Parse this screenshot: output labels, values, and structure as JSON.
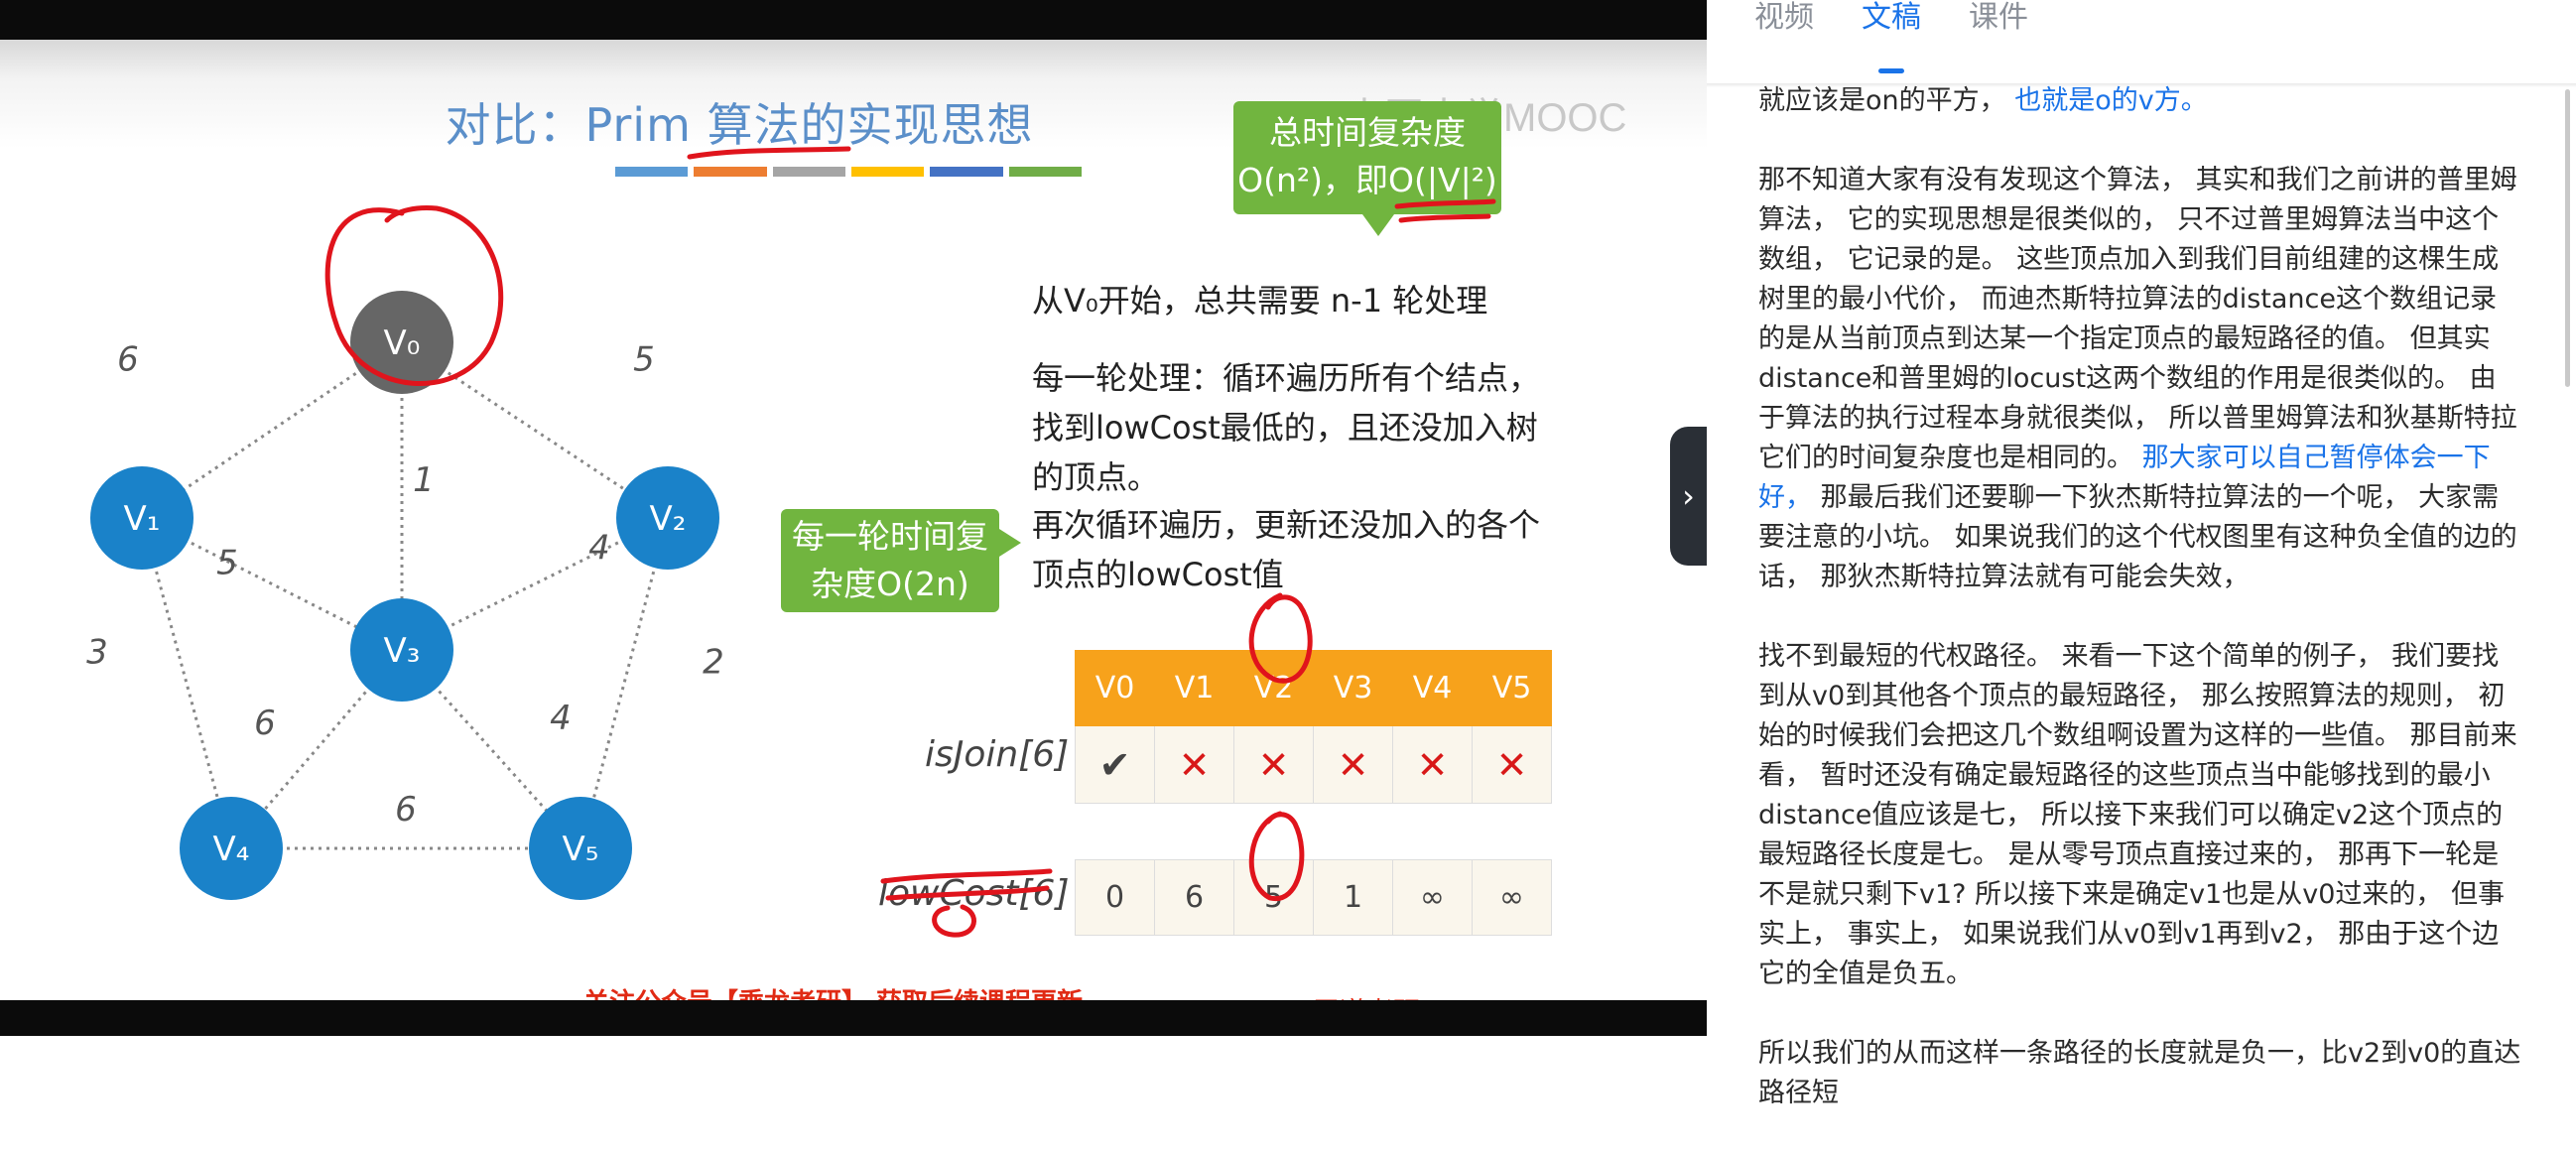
{
  "slide": {
    "title": "对比：Prim 算法的实现思想",
    "watermark": "中国大学MOOC",
    "stripe_colors": [
      "#5b9bd5",
      "#ed7d31",
      "#a5a5a5",
      "#ffc000",
      "#4472c4",
      "#70ad47"
    ],
    "bubble_total_line1": "总时间复杂度",
    "bubble_total_line2": "O(n²)，即O(|V|²)",
    "bubble_round_line1": "每一轮时间复",
    "bubble_round_line2": "杂度O(2n)",
    "line_start": "从V₀开始，总共需要 n-1 轮处理",
    "line_round": "每一轮处理：循环遍历所有个结点，找到lowCost最低的，且还没加入树的顶点。",
    "line_again": "再次循环遍历，更新还没加入的各个顶点的lowCost值",
    "isjoin_label": "isJoin[6]",
    "lowcost_label": "lowCost[6]",
    "table_headers": [
      "V0",
      "V1",
      "V2",
      "V3",
      "V4",
      "V5"
    ],
    "isjoin_values": [
      "✔",
      "✕",
      "✕",
      "✕",
      "✕",
      "✕"
    ],
    "lowcost_values": [
      "0",
      "6",
      "5",
      "1",
      "∞",
      "∞"
    ],
    "footer_promo": "关注公众号【乘龙考研】 获取后续课程更新",
    "footer_brand": "王道考研/CSKAOYAN.COM",
    "graph": {
      "nodes": [
        {
          "id": "v0",
          "label": "V₀"
        },
        {
          "id": "v1",
          "label": "V₁"
        },
        {
          "id": "v2",
          "label": "V₂"
        },
        {
          "id": "v3",
          "label": "V₃"
        },
        {
          "id": "v4",
          "label": "V₄"
        },
        {
          "id": "v5",
          "label": "V₅"
        }
      ],
      "edges": [
        {
          "from": "v0",
          "to": "v1",
          "weight": "6"
        },
        {
          "from": "v0",
          "to": "v2",
          "weight": "5"
        },
        {
          "from": "v0",
          "to": "v3",
          "weight": "1"
        },
        {
          "from": "v1",
          "to": "v3",
          "weight": "5"
        },
        {
          "from": "v2",
          "to": "v3",
          "weight": "4"
        },
        {
          "from": "v1",
          "to": "v4",
          "weight": "3"
        },
        {
          "from": "v2",
          "to": "v5",
          "weight": "2"
        },
        {
          "from": "v3",
          "to": "v4",
          "weight": "6"
        },
        {
          "from": "v3",
          "to": "v5",
          "weight": "4"
        },
        {
          "from": "v4",
          "to": "v5",
          "weight": "6"
        }
      ],
      "node_color": "#1a82c9",
      "start_node_color": "#666666"
    }
  },
  "panel": {
    "tabs": [
      {
        "label": "视频",
        "active": false
      },
      {
        "label": "文稿",
        "active": true
      },
      {
        "label": "课件",
        "active": false
      }
    ],
    "collapse_glyph": "›",
    "accent_color": "#1a73e8",
    "para1_a": "就应该是on的平方，",
    "para1_b": "也就是o的v方。",
    "para2_a": "那不知道大家有没有发现这个算法， 其实和我们之前讲的普里姆算法， 它的实现思想是很类似的， 只不过普里姆算法当中这个数组， 它记录的是。 这些顶点加入到我们目前组建的这棵生成树里的最小代价， 而迪杰斯特拉算法的distance这个数组记录的是从当前顶点到达某一个指定顶点的最短路径的值。 但其实distance和普里姆的locust这两个数组的作用是很类似的。 由于算法的执行过程本身就很类似， 所以普里姆算法和狄基斯特拉它们的时间复杂度也是相同的。",
    "para2_b": "那大家可以自己暂停体会一下好，",
    "para2_c": "那最后我们还要聊一下狄杰斯特拉算法的一个呢， 大家需要注意的小坑。 如果说我们的这个代权图里有这种负全值的边的话， 那狄杰斯特拉算法就有可能会失效，",
    "para3": "找不到最短的代权路径。 来看一下这个简单的例子， 我们要找到从v0到其他各个顶点的最短路径， 那么按照算法的规则， 初始的时候我们会把这几个数组啊设置为这样的一些值。 那目前来看， 暂时还没有确定最短路径的这些顶点当中能够找到的最小distance值应该是七， 所以接下来我们可以确定v2这个顶点的最短路径长度是七。 是从零号顶点直接过来的， 那再下一轮是不是就只剩下v1? 所以接下来是确定v1也是从v0过来的， 但事实上， 事实上， 如果说我们从v0到v1再到v2， 那由于这个边它的全值是负五。",
    "para4": "所以我们的从而这样一条路径的长度就是负一，比v2到v0的直达路径短"
  }
}
